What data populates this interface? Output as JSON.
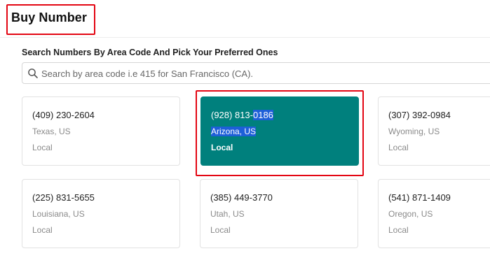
{
  "header": {
    "title": "Buy Number"
  },
  "search": {
    "label": "Search Numbers By Area Code And Pick Your Preferred Ones",
    "placeholder": "Search by area code i.e 415 for San Francisco (CA).",
    "value": ""
  },
  "selected_card": {
    "number_plain": "(928) 813-",
    "number_highlighted": "0186",
    "location": "Arizona, US",
    "type": "Local",
    "background_color": "#00807d"
  },
  "numbers": [
    {
      "number": "(409) 230-2604",
      "location": "Texas, US",
      "type": "Local"
    },
    {
      "number": "(307) 392-0984",
      "location": "Wyoming, US",
      "type": "Local"
    },
    {
      "number": "(225) 831-5655",
      "location": "Louisiana, US",
      "type": "Local"
    },
    {
      "number": "(385) 449-3770",
      "location": "Utah, US",
      "type": "Local"
    },
    {
      "number": "(541) 871-1409",
      "location": "Oregon, US",
      "type": "Local"
    }
  ],
  "colors": {
    "highlight_border": "#e30613",
    "selection": "#1e5fd8"
  }
}
